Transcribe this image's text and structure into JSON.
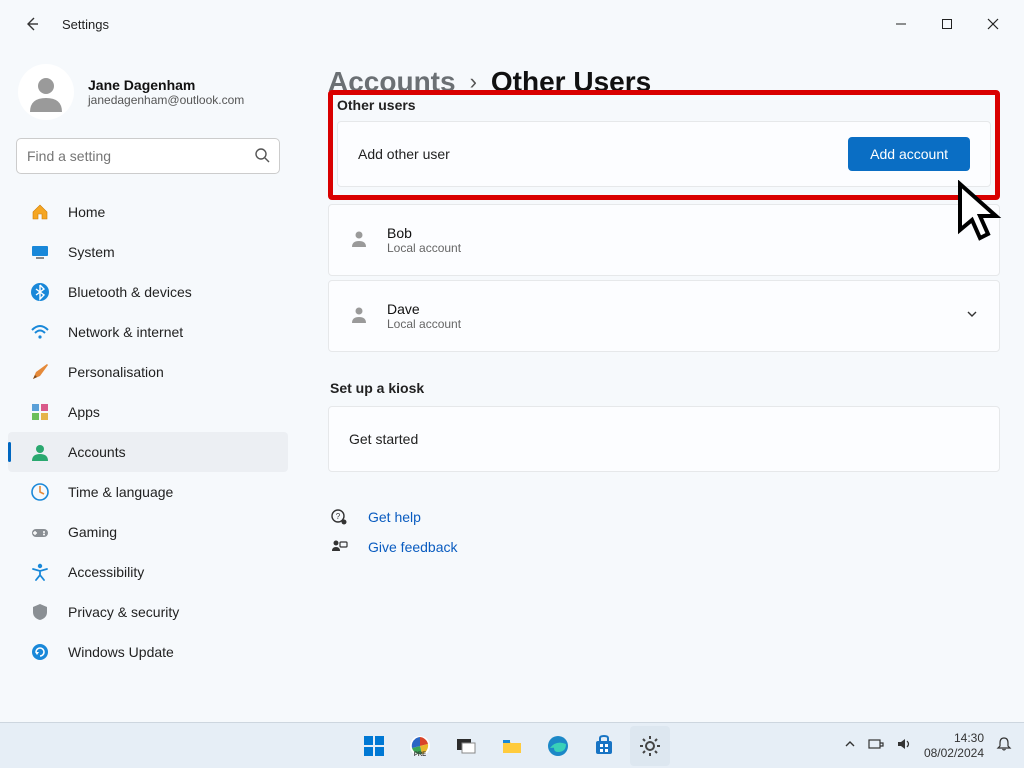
{
  "window": {
    "app_title": "Settings"
  },
  "profile": {
    "name": "Jane Dagenham",
    "email": "janedagenham@outlook.com"
  },
  "search": {
    "placeholder": "Find a setting"
  },
  "nav": [
    {
      "label": "Home"
    },
    {
      "label": "System"
    },
    {
      "label": "Bluetooth & devices"
    },
    {
      "label": "Network & internet"
    },
    {
      "label": "Personalisation"
    },
    {
      "label": "Apps"
    },
    {
      "label": "Accounts"
    },
    {
      "label": "Time & language"
    },
    {
      "label": "Gaming"
    },
    {
      "label": "Accessibility"
    },
    {
      "label": "Privacy & security"
    },
    {
      "label": "Windows Update"
    }
  ],
  "breadcrumb": {
    "parent": "Accounts",
    "current": "Other Users"
  },
  "sections": {
    "other_users_heading": "Other users",
    "add_other_user_label": "Add other user",
    "add_account_button": "Add account",
    "kiosk_heading": "Set up a kiosk",
    "kiosk_get_started": "Get started"
  },
  "users": [
    {
      "name": "Bob",
      "subtitle": "Local account"
    },
    {
      "name": "Dave",
      "subtitle": "Local account"
    }
  ],
  "help": {
    "get_help": "Get help",
    "give_feedback": "Give feedback"
  },
  "tray": {
    "time": "14:30",
    "date": "08/02/2024"
  }
}
